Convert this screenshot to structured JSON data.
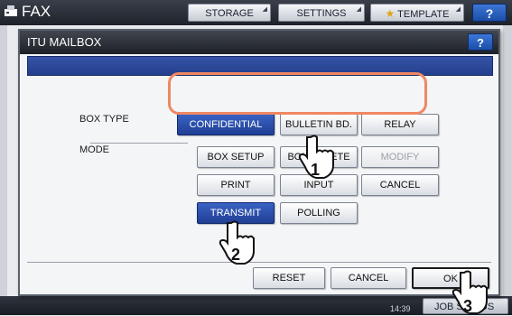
{
  "topbar": {
    "title": "FAX",
    "storage": "STORAGE",
    "settings": "SETTINGS",
    "template": "TEMPLATE",
    "help": "?"
  },
  "dialog": {
    "title": "ITU MAILBOX",
    "help": "?",
    "box_type_label": "BOX TYPE",
    "mode_label": "MODE",
    "box_type_buttons": [
      "CONFIDENTIAL",
      "BULLETIN BD.",
      "RELAY"
    ],
    "mode_buttons": [
      "BOX SETUP",
      "BOX DELETE",
      "MODIFY",
      "PRINT",
      "INPUT",
      "CANCEL",
      "TRANSMIT",
      "POLLING"
    ],
    "footer_buttons": {
      "reset": "RESET",
      "cancel": "CANCEL",
      "ok": "OK"
    }
  },
  "statusbar": {
    "time": "14:39",
    "job_status": "JOB STATUS"
  },
  "callouts": [
    "1",
    "2",
    "3"
  ],
  "colors": {
    "selected": "#2a4aa8",
    "highlight": "#ef8863",
    "title_bar": "#2a2e36"
  }
}
